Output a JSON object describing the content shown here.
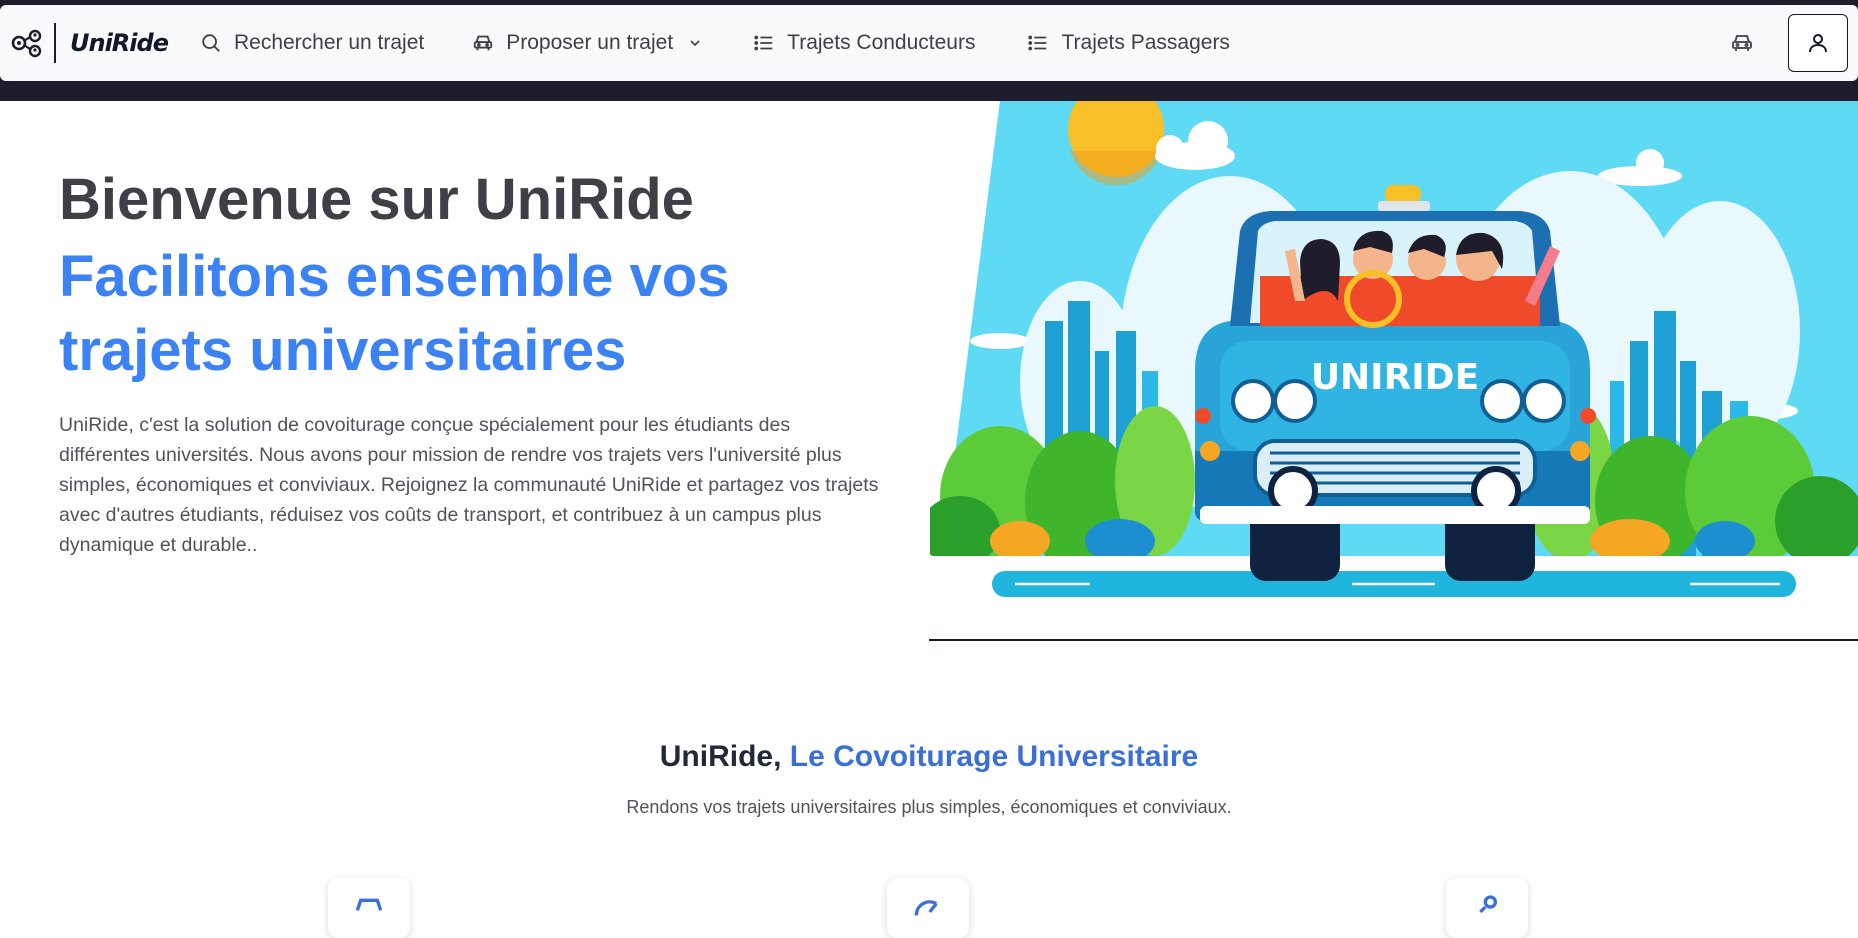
{
  "navbar": {
    "brand": "UniRide",
    "items": [
      {
        "label": "Rechercher un trajet",
        "icon": "search-icon"
      },
      {
        "label": "Proposer un trajet",
        "icon": "car-icon",
        "dropdown": true
      },
      {
        "label": "Trajets Conducteurs",
        "icon": "list-icon"
      },
      {
        "label": "Trajets Passagers",
        "icon": "list-icon"
      }
    ],
    "right_icons": [
      "car-icon",
      "user-icon"
    ]
  },
  "hero": {
    "title": "Bienvenue sur UniRide",
    "subtitle_line1": "Facilitons ensemble vos",
    "subtitle_line2": "trajets universitaires",
    "description": "UniRide, c'est la solution de covoiturage conçue spécialement pour les étudiants des différentes universités. Nous avons pour mission de rendre vos trajets vers l'université plus simples, économiques et conviviaux. Rejoignez la communauté UniRide et partagez vos trajets avec d'autres étudiants, réduisez vos coûts de transport, et contribuez à un campus plus dynamique et durable..",
    "image_text": "UNIRIDE"
  },
  "section": {
    "title_part1": "UniRide,",
    "title_part2": "Le Covoiturage Universitaire",
    "description": "Rendons vos trajets universitaires plus simples, économiques et conviviaux."
  },
  "colors": {
    "accent": "#3b82f6",
    "section_accent": "#3a6fd8",
    "text": "#3f3f46",
    "dark": "#1f1d2b"
  }
}
